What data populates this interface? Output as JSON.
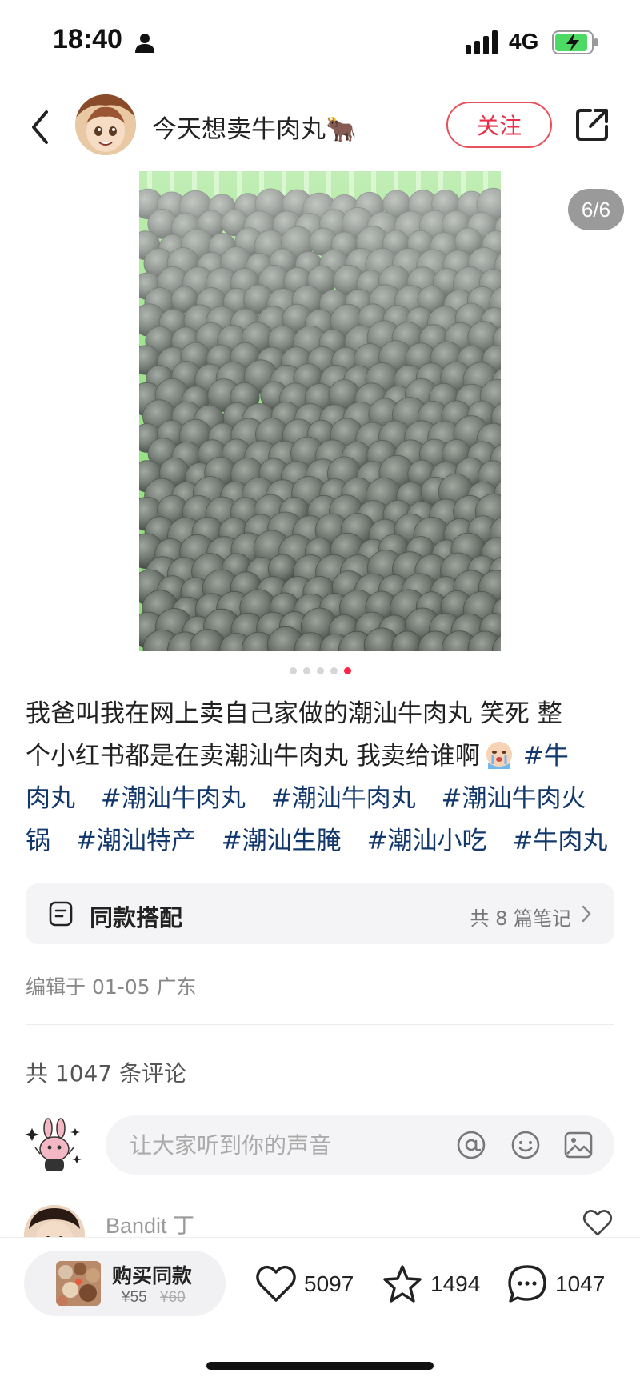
{
  "status_bar": {
    "time": "18:40",
    "network": "4G"
  },
  "header": {
    "author_name": "今天想卖牛肉丸🐂",
    "follow_label": "关注",
    "icons": [
      "back-icon",
      "share-icon"
    ]
  },
  "gallery": {
    "counter": "6/6",
    "total": 6,
    "current": 6,
    "dots_visible": 5
  },
  "caption": {
    "text_line1": "我爸叫我在网上卖自己家做的潮汕牛肉丸 笑死 整",
    "text_line2": "个小红书都是在卖潮汕牛肉丸 我卖给谁啊",
    "tags": [
      "#牛",
      "肉丸",
      "#潮汕牛肉丸",
      "#潮汕牛肉丸",
      "#潮汕牛肉火",
      "锅",
      "#潮汕特产",
      "#潮汕生腌",
      "#潮汕小吃",
      "#牛肉丸"
    ]
  },
  "match_card": {
    "title": "同款搭配",
    "count_text": "共 8 篇笔记"
  },
  "edit_info": "编辑于 01-05 广东",
  "comments": {
    "count_text": "共 1047 条评论",
    "input_placeholder": "让大家听到你的声音",
    "first_commenter": "Bandit 丁"
  },
  "bottom_bar": {
    "buy_label": "购买同款",
    "price": "¥55",
    "original_price": "¥60",
    "likes": "5097",
    "collects": "1494",
    "comments": "1047"
  },
  "colors": {
    "accent": "#ff2442",
    "tag": "#13386c",
    "basket": "#8fe07a"
  }
}
